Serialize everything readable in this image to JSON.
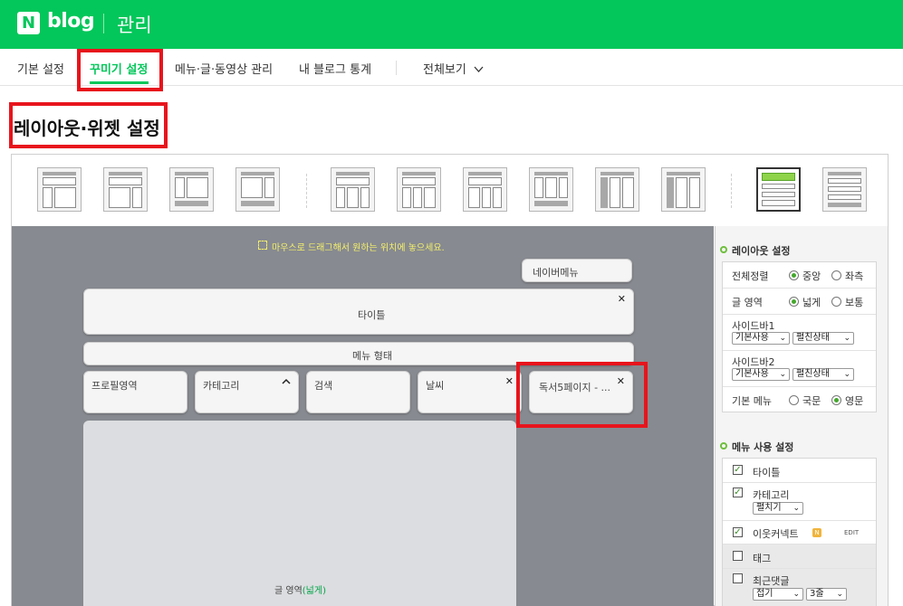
{
  "header": {
    "logo_mark": "N",
    "logo_text": "blog",
    "section": "관리"
  },
  "nav": {
    "items": [
      "기본 설정",
      "꾸미기 설정",
      "메뉴·글·동영상 관리",
      "내 블로그 통계",
      "전체보기"
    ],
    "active_index": 1,
    "dropdown_icon": "chevron-down-icon"
  },
  "page": {
    "title": "레이아웃·위젯 설정"
  },
  "canvas": {
    "hint": "마우스로 드래그해서 원하는 위치에 놓으세요.",
    "widgets": {
      "nav_menu": "네이버메뉴",
      "title": "타이틀",
      "menu_form": "메뉴 형태",
      "profile": "프로필영역",
      "category": "카테고리",
      "search": "검색",
      "weather": "날씨",
      "reading": "독서5페이지 - ..."
    },
    "main_area": {
      "label": "글 영역",
      "mode": "(넓게)"
    }
  },
  "panel": {
    "layout_title": "레이아웃 설정",
    "align_label": "전체정렬",
    "align_options": [
      "중앙",
      "좌측"
    ],
    "align_selected": 0,
    "area_label": "글 영역",
    "area_options": [
      "넓게",
      "보통"
    ],
    "area_selected": 0,
    "sidebar1_label": "사이드바1",
    "sidebar2_label": "사이드바2",
    "sidebar_opt1": "기본사용",
    "sidebar_opt2": "펼친상태",
    "basic_menu_label": "기본 메뉴",
    "basic_menu_options": [
      "국문",
      "영문"
    ],
    "basic_menu_selected": 1,
    "menu_title": "메뉴 사용 설정",
    "menu_items": {
      "title": "타이틀",
      "category": "카테고리",
      "category_select": "펼치기",
      "neighbor": "이웃커넥트",
      "neighbor_badge": "N",
      "neighbor_edit": "EDIT",
      "tag": "태그",
      "recent_comments": "최근댓글",
      "recent_select1": "접기",
      "recent_select2": "3줄"
    }
  },
  "colors": {
    "brand": "#03c75a",
    "highlight": "#e8141c",
    "canvas": "#878a90"
  }
}
